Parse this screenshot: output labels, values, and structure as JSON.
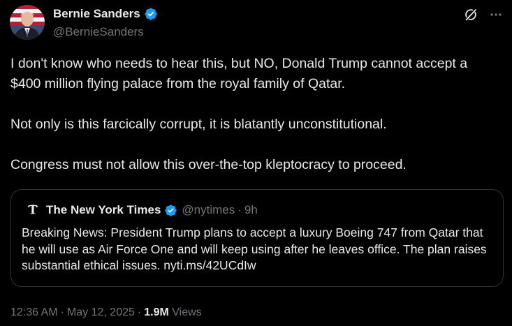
{
  "author": {
    "name": "Bernie Sanders",
    "handle": "@BernieSanders",
    "avatar_icon": "portrait-avatar",
    "verified_icon": "verified-badge-icon",
    "verified_color": "#1d9bf0"
  },
  "actions": {
    "grok_icon": "grok-icon",
    "more_icon": "more-icon"
  },
  "tweet": {
    "paragraphs": [
      "I don't know who needs to hear this, but NO, Donald Trump cannot accept a $400 million flying palace from the royal family of Qatar.",
      "Not only is this farcically corrupt, it is blatantly unconstitutional.",
      "Congress must not allow this over-the-top kleptocracy to proceed."
    ]
  },
  "quote": {
    "logo_icon": "nyt-logo-icon",
    "name": "The New York Times",
    "handle": "@nytimes",
    "dot": "·",
    "time": "9h",
    "text": "Breaking News: President Trump plans to accept a luxury Boeing 747 from Qatar that he will use as Air Force One and will keep using after he leaves office. The plan raises substantial ethical issues. nyti.ms/42UCdIw"
  },
  "meta": {
    "time": "12:36 AM",
    "dot1": "·",
    "date": "May 12, 2025",
    "dot2": "·",
    "views_count": "1.9M",
    "views_label": "Views"
  },
  "colors": {
    "background": "#000000",
    "text_primary": "#e7e9ea",
    "text_secondary": "#71767b",
    "border": "#2f3336",
    "accent": "#1d9bf0"
  }
}
